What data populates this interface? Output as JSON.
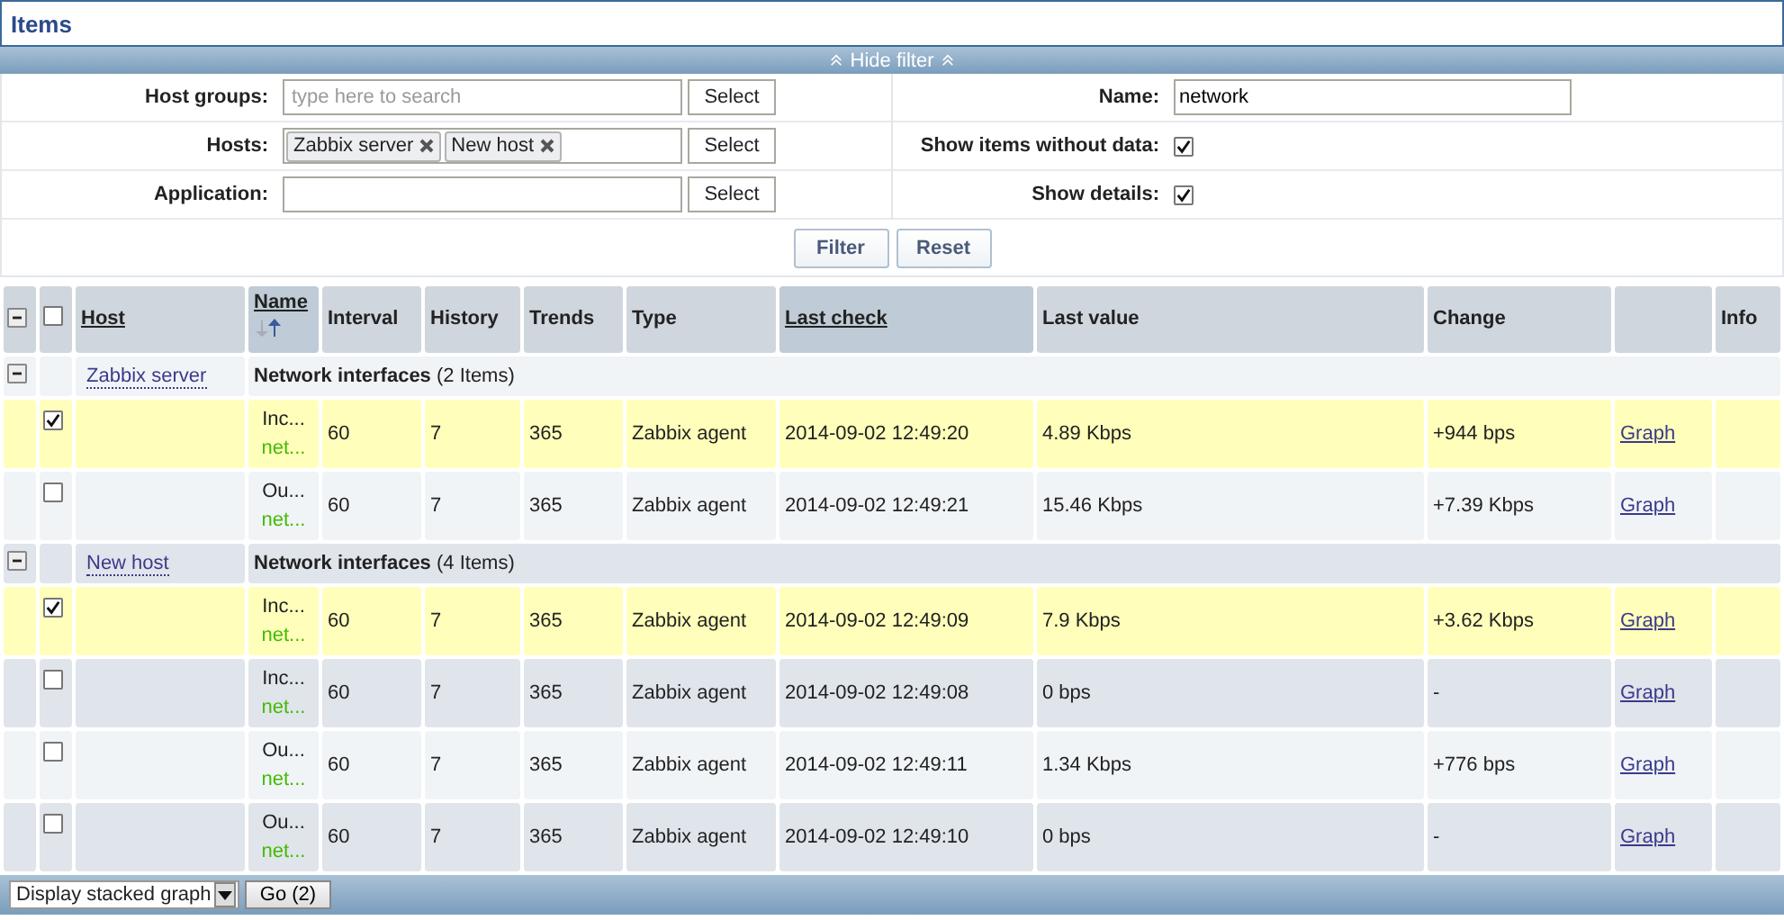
{
  "title": "Items",
  "filter": {
    "toggle": "Hide filter",
    "left": [
      {
        "kind": "multiselect",
        "label": "Host groups:",
        "placeholder": "type here to search",
        "button": "Select"
      },
      {
        "kind": "multiselect",
        "label": "Hosts:",
        "tags": [
          "Zabbix server",
          "New host"
        ],
        "button": "Select"
      },
      {
        "kind": "multiselect",
        "label": "Application:",
        "button": "Select"
      }
    ],
    "right": [
      {
        "kind": "text",
        "label": "Name:",
        "value": "network"
      },
      {
        "kind": "checkbox",
        "label": "Show items without data:",
        "checked": true
      },
      {
        "kind": "checkbox",
        "label": "Show details:",
        "checked": true
      }
    ],
    "buttons": [
      "Filter",
      "Reset"
    ]
  },
  "table": {
    "all_expanded": true,
    "all_checked": false,
    "columns": [
      {
        "kind": "label",
        "label": "Host",
        "underlined": true,
        "highlighted": false
      },
      {
        "kind": "label",
        "label": "Name",
        "underlined": true,
        "highlighted": true,
        "sorted_ascending": true
      },
      {
        "kind": "label",
        "label": "Interval",
        "underlined": false,
        "highlighted": false
      },
      {
        "kind": "label",
        "label": "History",
        "underlined": false,
        "highlighted": false
      },
      {
        "kind": "label",
        "label": "Trends",
        "underlined": false,
        "highlighted": false
      },
      {
        "kind": "label",
        "label": "Type",
        "underlined": false,
        "highlighted": false
      },
      {
        "kind": "label",
        "label": "Last check",
        "underlined": true,
        "highlighted": true
      },
      {
        "kind": "label",
        "label": "Last value",
        "underlined": false,
        "highlighted": false
      },
      {
        "kind": "label",
        "label": "Change",
        "underlined": false,
        "highlighted": false
      },
      {
        "kind": "blank"
      },
      {
        "kind": "label",
        "label": "Info",
        "underlined": false,
        "highlighted": false
      }
    ],
    "groups": [
      {
        "expanded": true,
        "host": "Zabbix server",
        "application": "**Network interfaces** (2 Items)",
        "items": [
          {
            "selected": true,
            "name": "Inc...",
            "key": "net...",
            "interval": "60",
            "history": "7",
            "trends": "365",
            "type": "Zabbix agent",
            "last_check": "2014-09-02 12:49:20",
            "last_value": "4.89 Kbps",
            "change": "+944 bps",
            "graph": "Graph"
          },
          {
            "selected": false,
            "name": "Ou...",
            "key": "net...",
            "interval": "60",
            "history": "7",
            "trends": "365",
            "type": "Zabbix agent",
            "last_check": "2014-09-02 12:49:21",
            "last_value": "15.46 Kbps",
            "change": "+7.39 Kbps",
            "graph": "Graph"
          }
        ]
      },
      {
        "expanded": true,
        "host": "New host",
        "application": "**Network interfaces** (4 Items)",
        "items": [
          {
            "selected": true,
            "name": "Inc...",
            "key": "net...",
            "interval": "60",
            "history": "7",
            "trends": "365",
            "type": "Zabbix agent",
            "last_check": "2014-09-02 12:49:09",
            "last_value": "7.9 Kbps",
            "change": "+3.62 Kbps",
            "graph": "Graph"
          },
          {
            "selected": false,
            "name": "Inc...",
            "key": "net...",
            "interval": "60",
            "history": "7",
            "trends": "365",
            "type": "Zabbix agent",
            "last_check": "2014-09-02 12:49:08",
            "last_value": "0 bps",
            "change": "-",
            "graph": "Graph"
          },
          {
            "selected": false,
            "name": "Ou...",
            "key": "net...",
            "interval": "60",
            "history": "7",
            "trends": "365",
            "type": "Zabbix agent",
            "last_check": "2014-09-02 12:49:11",
            "last_value": "1.34 Kbps",
            "change": "+776 bps",
            "graph": "Graph"
          },
          {
            "selected": false,
            "name": "Ou...",
            "key": "net...",
            "interval": "60",
            "history": "7",
            "trends": "365",
            "type": "Zabbix agent",
            "last_check": "2014-09-02 12:49:10",
            "last_value": "0 bps",
            "change": "-",
            "graph": "Graph"
          }
        ]
      }
    ]
  },
  "footer": {
    "action": "Display stacked graph",
    "button": "Go (2)"
  }
}
